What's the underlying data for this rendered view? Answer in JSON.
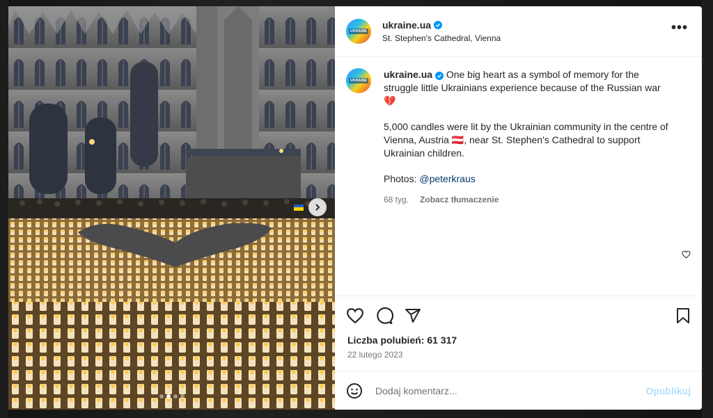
{
  "post": {
    "username": "ukraine.ua",
    "location": "St. Stephen's Cathedral, Vienna",
    "avatar_label": "UKRAINE",
    "caption_line1": "One big heart as a symbol of memory for the struggle little Ukrainians experience because of the Russian war",
    "caption_emoji": "💔",
    "caption_line2": "5,000 candles were lit by the Ukrainian community in the centre of Vienna, Austria 🇦🇹, near St. Stephen's Cathedral to support Ukrainian children.",
    "photos_label": "Photos:",
    "photos_mention": "@peterkraus",
    "time_ago": "68 tyg.",
    "translate_label": "Zobacz tłumaczenie",
    "likes_text": "Liczba polubień: 61 317",
    "date": "22 lutego 2023",
    "comment_placeholder": "Dodaj komentarz...",
    "publish_label": "Opublikuj"
  },
  "carousel": {
    "slide_count": 4,
    "active_index": 1
  },
  "icons": {
    "more": "more-options-icon",
    "like": "heart-icon",
    "comment": "comment-icon",
    "share": "share-icon",
    "save": "bookmark-icon",
    "emoji": "emoji-icon",
    "next": "chevron-right-icon"
  },
  "colors": {
    "verified": "#0095f6",
    "mention": "#00376b",
    "publish_disabled": "#b2dffc",
    "heart_emoji": "#e0245e"
  }
}
